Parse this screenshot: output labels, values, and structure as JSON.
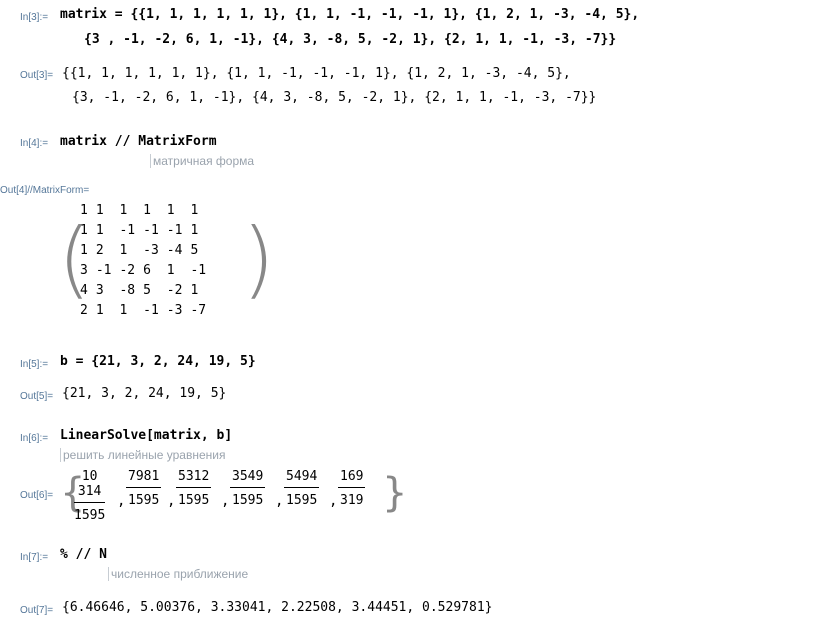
{
  "in3": {
    "label": "In[3]:=",
    "line1": "matrix = {{1, 1, 1, 1, 1, 1}, {1, 1, -1, -1, -1, 1}, {1, 2, 1, -3, -4, 5},",
    "line2": "{3 , -1, -2, 6, 1, -1}, {4, 3, -8, 5, -2, 1}, {2, 1, 1, -1, -3, -7}}"
  },
  "out3": {
    "label": "Out[3]=",
    "line1": "{{1, 1, 1, 1, 1, 1}, {1, 1, -1, -1, -1, 1}, {1, 2, 1, -3, -4, 5},",
    "line2": "{3, -1, -2, 6, 1, -1}, {4, 3, -8, 5, -2, 1}, {2, 1, 1, -1, -3, -7}}"
  },
  "in4": {
    "label": "In[4]:=",
    "code": "matrix // MatrixForm",
    "hint": "матричная форма"
  },
  "out4": {
    "label": "Out[4]//MatrixForm=",
    "rows": [
      [
        "1",
        "1",
        "1",
        "1",
        "1",
        "1"
      ],
      [
        "1",
        "1",
        "-1",
        "-1",
        "-1",
        "1"
      ],
      [
        "1",
        "2",
        "1",
        "-3",
        "-4",
        "5"
      ],
      [
        "3",
        "-1",
        "-2",
        "6",
        "1",
        "-1"
      ],
      [
        "4",
        "3",
        "-8",
        "5",
        "-2",
        "1"
      ],
      [
        "2",
        "1",
        "1",
        "-1",
        "-3",
        "-7"
      ]
    ]
  },
  "in5": {
    "label": "In[5]:=",
    "code": "b = {21, 3, 2, 24, 19, 5}"
  },
  "out5": {
    "label": "Out[5]=",
    "value": "{21, 3, 2, 24, 19, 5}"
  },
  "in6": {
    "label": "In[6]:=",
    "code": "LinearSolve[matrix, b]",
    "hint": "решить линейные уравнения"
  },
  "out6": {
    "label": "Out[6]=",
    "fractions": [
      {
        "num": "10 314",
        "den": "1595"
      },
      {
        "num": "7981",
        "den": "1595"
      },
      {
        "num": "5312",
        "den": "1595"
      },
      {
        "num": "3549",
        "den": "1595"
      },
      {
        "num": "5494",
        "den": "1595"
      },
      {
        "num": "169",
        "den": "319"
      }
    ]
  },
  "in7": {
    "label": "In[7]:=",
    "code": "% // N",
    "hint": "численное приближение"
  },
  "out7": {
    "label": "Out[7]=",
    "value": "{6.46646, 5.00376, 3.33041, 2.22508, 3.44451, 0.529781}"
  }
}
